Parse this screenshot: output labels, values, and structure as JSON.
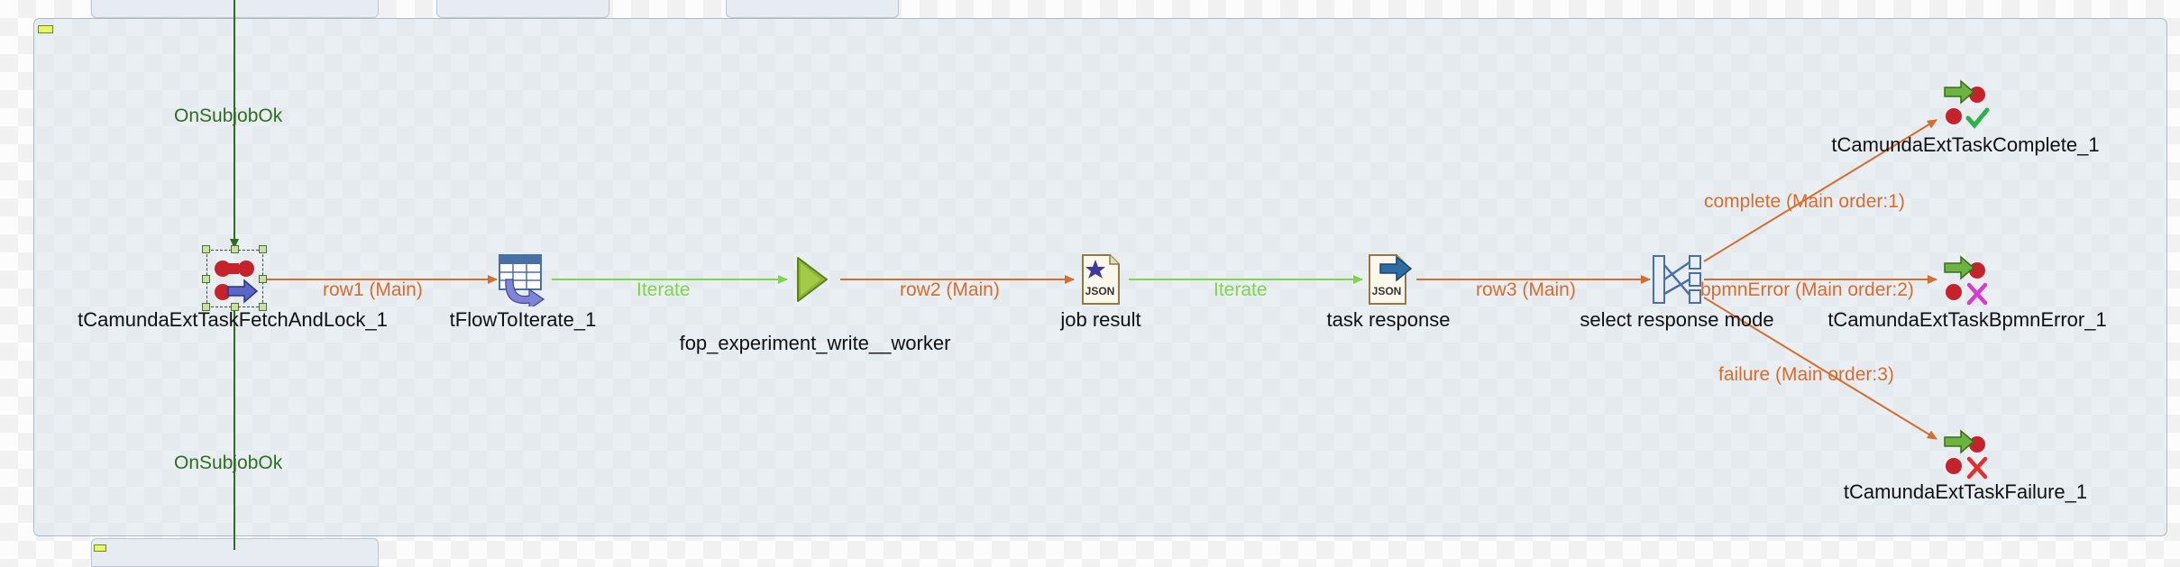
{
  "triggers": {
    "top": "OnSubjobOk",
    "bottom": "OnSubjobOk"
  },
  "components": {
    "fetch": {
      "name": "tCamundaExtTaskFetchAndLock_1",
      "icon": "camunda-fetch-icon"
    },
    "flow_to_iterate": {
      "name": "tFlowToIterate_1",
      "icon": "flow-to-iterate-icon"
    },
    "fop": {
      "name": "fop_experiment_write__worker",
      "icon": "subjob-run-icon"
    },
    "job_result": {
      "name": "job result",
      "icon": "json-input-icon"
    },
    "task_response": {
      "name": "task response",
      "icon": "json-output-icon"
    },
    "select_mode": {
      "name": "select response mode",
      "icon": "tmap-icon"
    },
    "complete": {
      "name": "tCamundaExtTaskComplete_1",
      "icon": "camunda-complete-icon"
    },
    "bpmn": {
      "name": "tCamundaExtTaskBpmnError_1",
      "icon": "camunda-bpmn-error-icon"
    },
    "failure": {
      "name": "tCamundaExtTaskFailure_1",
      "icon": "camunda-failure-icon"
    }
  },
  "links": {
    "row1": "row1 (Main)",
    "iterate1": "Iterate",
    "row2": "row2 (Main)",
    "iterate2": "Iterate",
    "row3": "row3 (Main)",
    "complete": "complete (Main order:1)",
    "bpmn": "bpmnError (Main order:2)",
    "failure": "failure (Main order:3)"
  },
  "colors": {
    "main_link": "#d56d2e",
    "iterate_link": "#7fd44a",
    "trigger_link": "#2d6e1e",
    "subjob_bg": "#dae4ec"
  }
}
